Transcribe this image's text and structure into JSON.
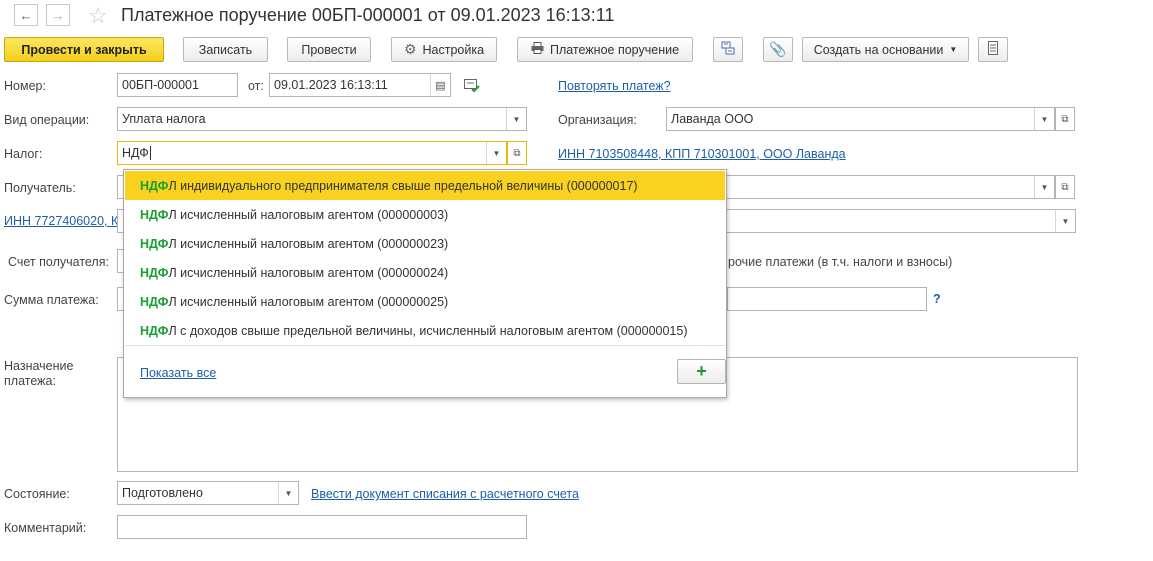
{
  "window": {
    "title": "Платежное поручение 00БП-000001 от 09.01.2023 16:13:11",
    "back_icon": "arrow-left",
    "forward_icon": "arrow-right",
    "favorite_icon": "star"
  },
  "toolbar": {
    "post_and_close": "Провести и закрыть",
    "save": "Записать",
    "post": "Провести",
    "settings": "Настройка",
    "print_payment_order": "Платежное поручение",
    "create_based_on": "Создать на основании"
  },
  "form": {
    "number_label": "Номер:",
    "number_value": "00БП-000001",
    "date_label": "от:",
    "date_value": "09.01.2023 16:13:11",
    "repeat_payment_link": "Повторять платеж?",
    "operation_label": "Вид операции:",
    "operation_value": "Уплата налога",
    "organization_label": "Организация:",
    "organization_value": "Лаванда ООО",
    "tax_label": "Налог:",
    "tax_value": "НДФ",
    "org_details_link": "ИНН 7103508448, КПП 710301001, ООО Лаванда",
    "recipient_label": "Получатель:",
    "recipient_inn_link": "ИНН 7727406020, К",
    "recipient_account_label": "Счет получателя:",
    "other_payments_text": "рочие платежи (в т.ч. налоги и взносы)",
    "amount_label": "Сумма платежа:",
    "help_mark": "?",
    "purpose_label_line1": "Назначение",
    "purpose_label_line2": "платежа:",
    "state_label": "Состояние:",
    "state_value": "Подготовлено",
    "write_off_link": "Ввести документ списания с расчетного счета",
    "comment_label": "Комментарий:"
  },
  "dropdown": {
    "match_text": "НДФ",
    "items": [
      {
        "rest": "Л индивидуального предпринимателя свыше предельной величины (000000017)",
        "selected": true
      },
      {
        "rest": "Л исчисленный налоговым агентом (000000003)",
        "selected": false
      },
      {
        "rest": "Л исчисленный налоговым агентом (000000023)",
        "selected": false
      },
      {
        "rest": "Л исчисленный налоговым агентом (000000024)",
        "selected": false
      },
      {
        "rest": "Л исчисленный налоговым агентом (000000025)",
        "selected": false
      },
      {
        "rest": "Л с доходов свыше предельной величины, исчисленный налоговым агентом (000000015)",
        "selected": false
      }
    ],
    "show_all_link": "Показать все",
    "add_button_label": "+"
  },
  "colors": {
    "primary_button": "#f3cf1c",
    "selected_item": "#f9d11f",
    "link": "#1d5fa8",
    "match_highlight": "#18a033"
  }
}
